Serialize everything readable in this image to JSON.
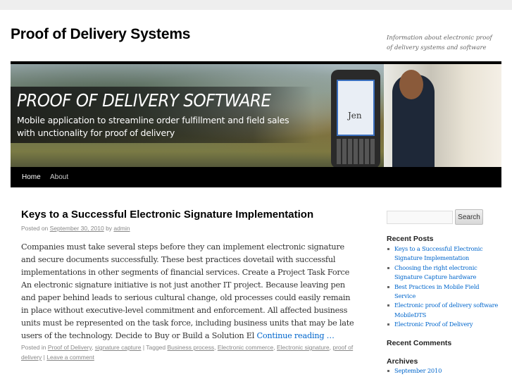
{
  "site": {
    "title": "Proof of Delivery Systems",
    "description": "Information about electronic proof of delivery systems and software"
  },
  "banner": {
    "title": "PROOF OF DELIVERY SOFTWARE",
    "subtitle": "Mobile application to streamline order fulfillment and field sales with unctionality for proof of delivery",
    "signature": "Jen"
  },
  "nav": {
    "items": [
      {
        "label": "Home"
      },
      {
        "label": "About"
      }
    ]
  },
  "post": {
    "title": "Keys to a Successful Electronic Signature Implementation",
    "posted_on": "Posted on",
    "date": "September 30, 2010",
    "by": "by",
    "author": "admin",
    "body": "Companies must take several steps before they can implement electronic signature and secure documents successfully. These best practices dovetail with successful implementations in other segments of financial services. Create a Project Task Force An electronic signature initiative is not just another IT project. Because leaving pen and paper behind leads to serious cultural change, old processes could easily remain in place without executive-level commitment and enforcement. All affected business units must be represented on the task force, including business units that may be late users of the technology. Decide to Buy or Build a Solution El ",
    "continue": "Continue reading …",
    "posted_in": "Posted in",
    "categories": [
      "Proof of Delivery",
      "signature capture"
    ],
    "tagged": "| Tagged",
    "tags": [
      "Business process",
      "Electronic commerce",
      "Electronic signature",
      "proof of delivery"
    ],
    "sep": "|",
    "comment": "Leave a comment"
  },
  "sidebar": {
    "search_button": "Search",
    "search_value": "",
    "recent_posts_title": "Recent Posts",
    "recent_posts": [
      "Keys to a Successful Electronic Signature Implementation",
      "Choosing the right electronic Signature Capture hardware",
      "Best Practices in Mobile Field Service",
      "Electronic proof of delivery software MobileDTS",
      "Electronic Proof of Delivery"
    ],
    "recent_comments_title": "Recent Comments",
    "archives_title": "Archives",
    "archives": [
      "September 2010"
    ]
  },
  "colors": {
    "link": "#0066cc",
    "nav_bg": "#000000"
  }
}
